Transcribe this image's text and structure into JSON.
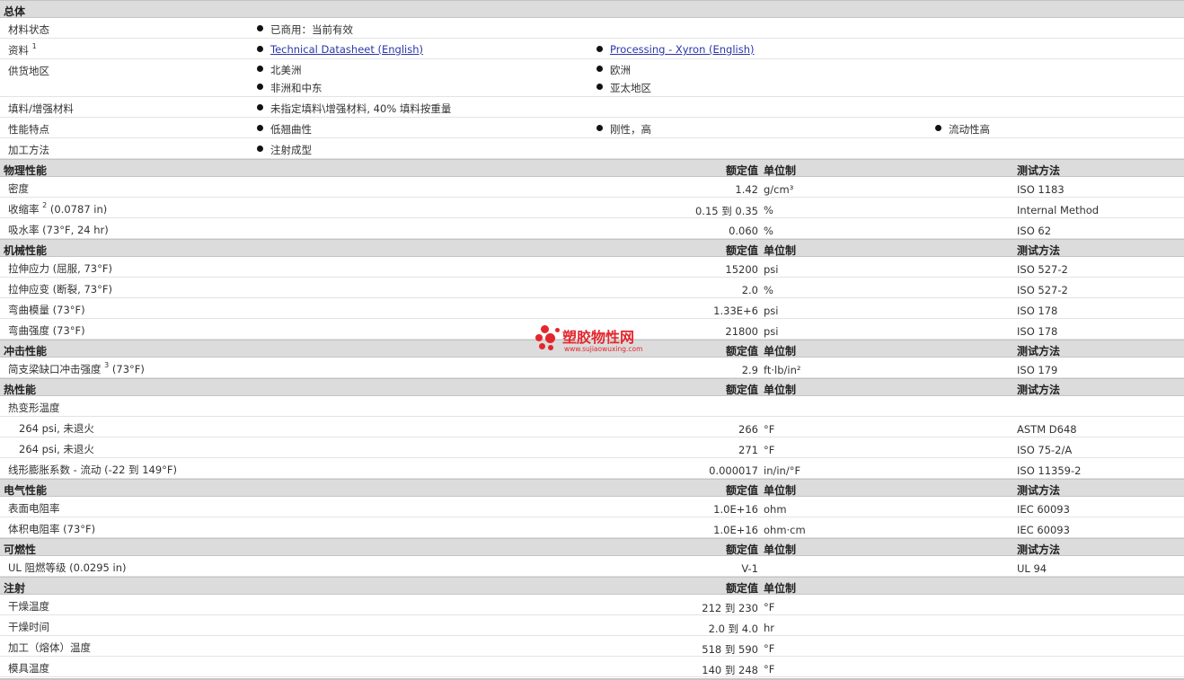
{
  "overall": {
    "title": "总体",
    "status": {
      "label": "材料状态",
      "value": "已商用：当前有效"
    },
    "docs": {
      "label": "资料",
      "sup": "1",
      "link1": "Technical Datasheet (English)",
      "link2": "Processing - Xyron (English)"
    },
    "region": {
      "label": "供货地区",
      "items": [
        "北美洲",
        "欧洲",
        "非洲和中东",
        "亚太地区"
      ]
    },
    "filler": {
      "label": "填料/增强材料",
      "value": "未指定填料\\增强材料, 40% 填料按重量"
    },
    "features": {
      "label": "性能特点",
      "items": [
        "低翘曲性",
        "刚性，高",
        "流动性高"
      ]
    },
    "processing": {
      "label": "加工方法",
      "value": "注射成型"
    }
  },
  "col_headers": {
    "nominal": "额定值",
    "unit": "单位制",
    "method": "测试方法"
  },
  "physical": {
    "title": "物理性能",
    "rows": [
      {
        "label": "密度",
        "value": "1.42",
        "unit": "g/cm³",
        "method": "ISO 1183"
      },
      {
        "label": "收缩率",
        "sup": "2",
        "cond": " (0.0787 in)",
        "value": "0.15 到  0.35",
        "unit": "%",
        "method": "Internal Method"
      },
      {
        "label": "吸水率  (73°F, 24 hr)",
        "value": "0.060",
        "unit": "%",
        "method": "ISO 62"
      }
    ]
  },
  "mechanical": {
    "title": "机械性能",
    "rows": [
      {
        "label": "拉伸应力  (屈服, 73°F)",
        "value": "15200",
        "unit": "psi",
        "method": "ISO 527-2"
      },
      {
        "label": "拉伸应变  (断裂, 73°F)",
        "value": "2.0",
        "unit": "%",
        "method": "ISO 527-2"
      },
      {
        "label": "弯曲模量  (73°F)",
        "value": "1.33E+6",
        "unit": "psi",
        "method": "ISO 178"
      },
      {
        "label": "弯曲强度  (73°F)",
        "value": "21800",
        "unit": "psi",
        "method": "ISO 178"
      }
    ]
  },
  "impact": {
    "title": "冲击性能",
    "rows": [
      {
        "label": "简支梁缺口冲击强度",
        "sup": "3",
        "cond": " (73°F)",
        "value": "2.9",
        "unit": "ft·lb/in²",
        "method": "ISO 179"
      }
    ]
  },
  "thermal": {
    "title": "热性能",
    "group": "热变形温度",
    "rows": [
      {
        "label": "264 psi, 未退火",
        "value": "266",
        "unit": "°F",
        "method": "ASTM D648"
      },
      {
        "label": "264 psi, 未退火",
        "value": "271",
        "unit": "°F",
        "method": "ISO 75-2/A"
      },
      {
        "label": "线形膨胀系数  - 流动  (-22 到  149°F)",
        "value": "0.000017",
        "unit": "in/in/°F",
        "method": "ISO 11359-2"
      }
    ]
  },
  "electrical": {
    "title": "电气性能",
    "rows": [
      {
        "label": "表面电阻率",
        "value": "1.0E+16",
        "unit": "ohm",
        "method": "IEC 60093"
      },
      {
        "label": "体积电阻率  (73°F)",
        "value": "1.0E+16",
        "unit": "ohm·cm",
        "method": "IEC 60093"
      }
    ]
  },
  "flammability": {
    "title": "可燃性",
    "rows": [
      {
        "label": "UL 阻燃等级  (0.0295 in)",
        "value": "V-1",
        "unit": "",
        "method": "UL 94"
      }
    ]
  },
  "injection": {
    "title": "注射",
    "rows": [
      {
        "label": "干燥温度",
        "value": "212 到  230",
        "unit": "°F"
      },
      {
        "label": "干燥时间",
        "value": "2.0 到  4.0",
        "unit": "hr"
      },
      {
        "label": "加工（熔体）温度",
        "value": "518 到  590",
        "unit": "°F"
      },
      {
        "label": "模具温度",
        "value": "140 到  248",
        "unit": "°F"
      }
    ]
  },
  "watermark": {
    "cn": "塑胶物性网",
    "en": "www.sujiaowuxing.com",
    "color": "#e3262d"
  }
}
